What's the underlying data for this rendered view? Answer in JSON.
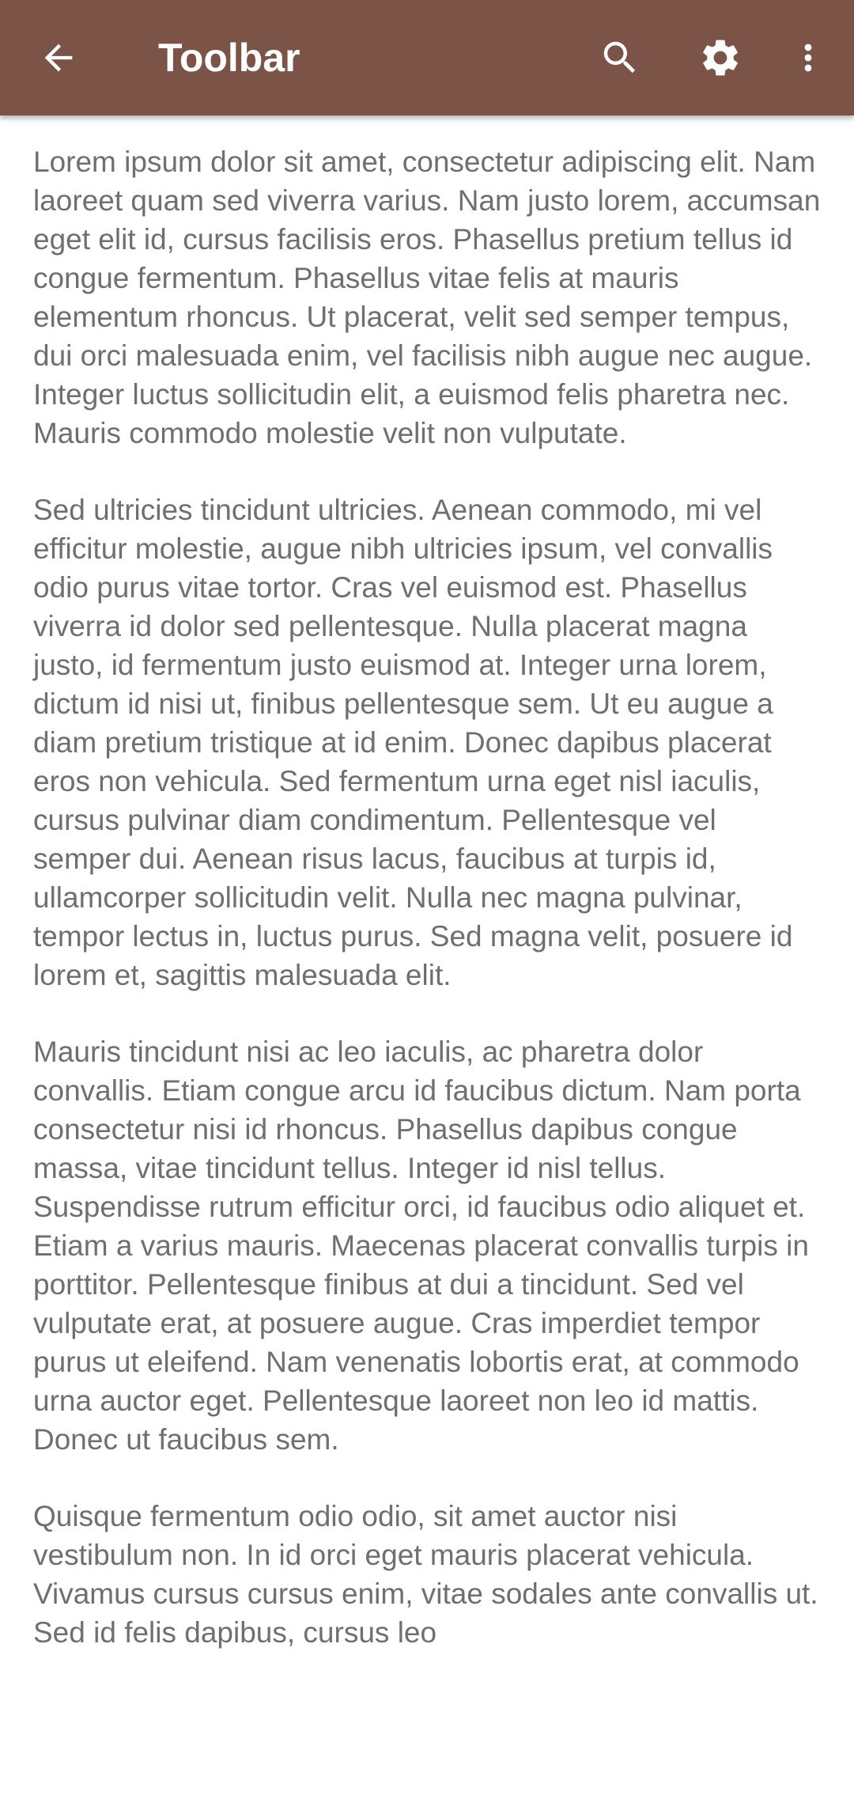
{
  "toolbar": {
    "title": "Toolbar",
    "background_color": "#7b5447",
    "icons": {
      "back": "arrow-back-icon",
      "search": "search-icon",
      "settings": "gear-icon",
      "overflow": "more-vert-icon"
    }
  },
  "content": {
    "text_color": "#6f6f6f",
    "paragraphs": [
      "Lorem ipsum dolor sit amet, consectetur adipiscing elit. Nam laoreet quam sed viverra varius. Nam justo lorem, accumsan eget elit id, cursus facilisis eros. Phasellus pretium tellus id congue fermentum. Phasellus vitae felis at mauris elementum rhoncus. Ut placerat, velit sed semper tempus, dui orci malesuada enim, vel facilisis nibh augue nec augue. Integer luctus sollicitudin elit, a euismod felis pharetra nec. Mauris commodo molestie velit non vulputate.",
      "Sed ultricies tincidunt ultricies. Aenean commodo, mi vel efficitur molestie, augue nibh ultricies ipsum, vel convallis odio purus vitae tortor. Cras vel euismod est. Phasellus viverra id dolor sed pellentesque. Nulla placerat magna justo, id fermentum justo euismod at. Integer urna lorem, dictum id nisi ut, finibus pellentesque sem. Ut eu augue a diam pretium tristique at id enim. Donec dapibus placerat eros non vehicula. Sed fermentum urna eget nisl iaculis, cursus pulvinar diam condimentum. Pellentesque vel semper dui. Aenean risus lacus, faucibus at turpis id, ullamcorper sollicitudin velit. Nulla nec magna pulvinar, tempor lectus in, luctus purus. Sed magna velit, posuere id lorem et, sagittis malesuada elit.",
      "Mauris tincidunt nisi ac leo iaculis, ac pharetra dolor convallis. Etiam congue arcu id faucibus dictum. Nam porta consectetur nisi id rhoncus. Phasellus dapibus congue massa, vitae tincidunt tellus. Integer id nisl tellus. Suspendisse rutrum efficitur orci, id faucibus odio aliquet et. Etiam a varius mauris. Maecenas placerat convallis turpis in porttitor. Pellentesque finibus at dui a tincidunt. Sed vel vulputate erat, at posuere augue. Cras imperdiet tempor purus ut eleifend. Nam venenatis lobortis erat, at commodo urna auctor eget. Pellentesque laoreet non leo id mattis. Donec ut faucibus sem.",
      "Quisque fermentum odio odio, sit amet auctor nisi vestibulum non. In id orci eget mauris placerat vehicula. Vivamus cursus cursus enim, vitae sodales ante convallis ut. Sed id felis dapibus, cursus leo"
    ]
  }
}
